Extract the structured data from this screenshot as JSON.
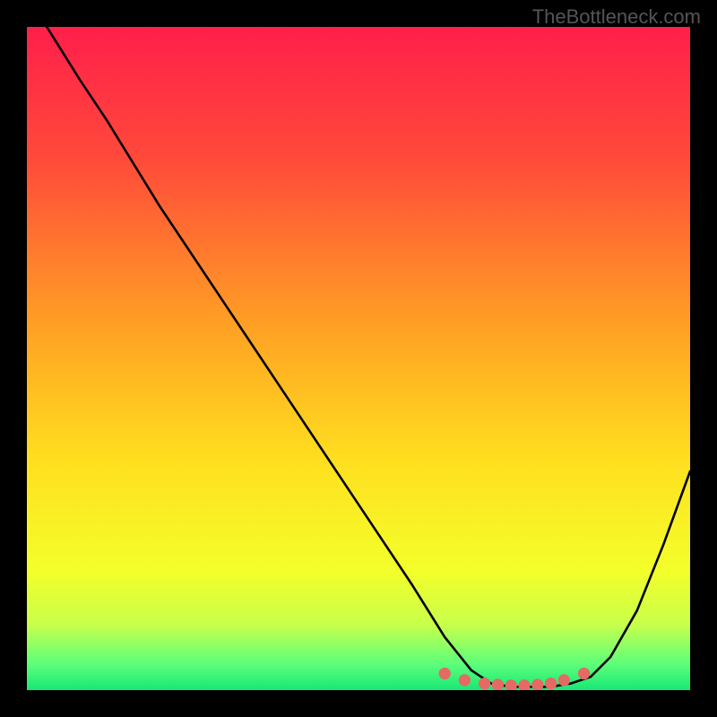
{
  "watermark": "TheBottleneck.com",
  "chart_data": {
    "type": "line",
    "title": "",
    "xlabel": "",
    "ylabel": "",
    "xlim": [
      0,
      100
    ],
    "ylim": [
      0,
      100
    ],
    "series": [
      {
        "name": "bottleneck-curve",
        "x": [
          3,
          8,
          12,
          20,
          30,
          40,
          50,
          58,
          63,
          67,
          70,
          73,
          76,
          79,
          82,
          85,
          88,
          92,
          96,
          100
        ],
        "y": [
          100,
          92,
          86,
          73,
          58,
          43,
          28,
          16,
          8,
          3,
          1,
          0.5,
          0.5,
          0.5,
          1,
          2,
          5,
          12,
          22,
          33
        ]
      }
    ],
    "markers": {
      "name": "flat-region-dots",
      "x": [
        63,
        66,
        69,
        71,
        73,
        75,
        77,
        79,
        81,
        84
      ],
      "y": [
        2.5,
        1.5,
        1,
        0.8,
        0.7,
        0.7,
        0.8,
        1,
        1.5,
        2.5
      ]
    },
    "gradient_stops": [
      {
        "pct": 0,
        "color": "#ff1f4b"
      },
      {
        "pct": 20,
        "color": "#ff4a3a"
      },
      {
        "pct": 45,
        "color": "#ffa024"
      },
      {
        "pct": 65,
        "color": "#ffde1f"
      },
      {
        "pct": 82,
        "color": "#f3ff2a"
      },
      {
        "pct": 90,
        "color": "#c9ff4a"
      },
      {
        "pct": 96,
        "color": "#5eff7a"
      },
      {
        "pct": 100,
        "color": "#17e874"
      }
    ]
  }
}
